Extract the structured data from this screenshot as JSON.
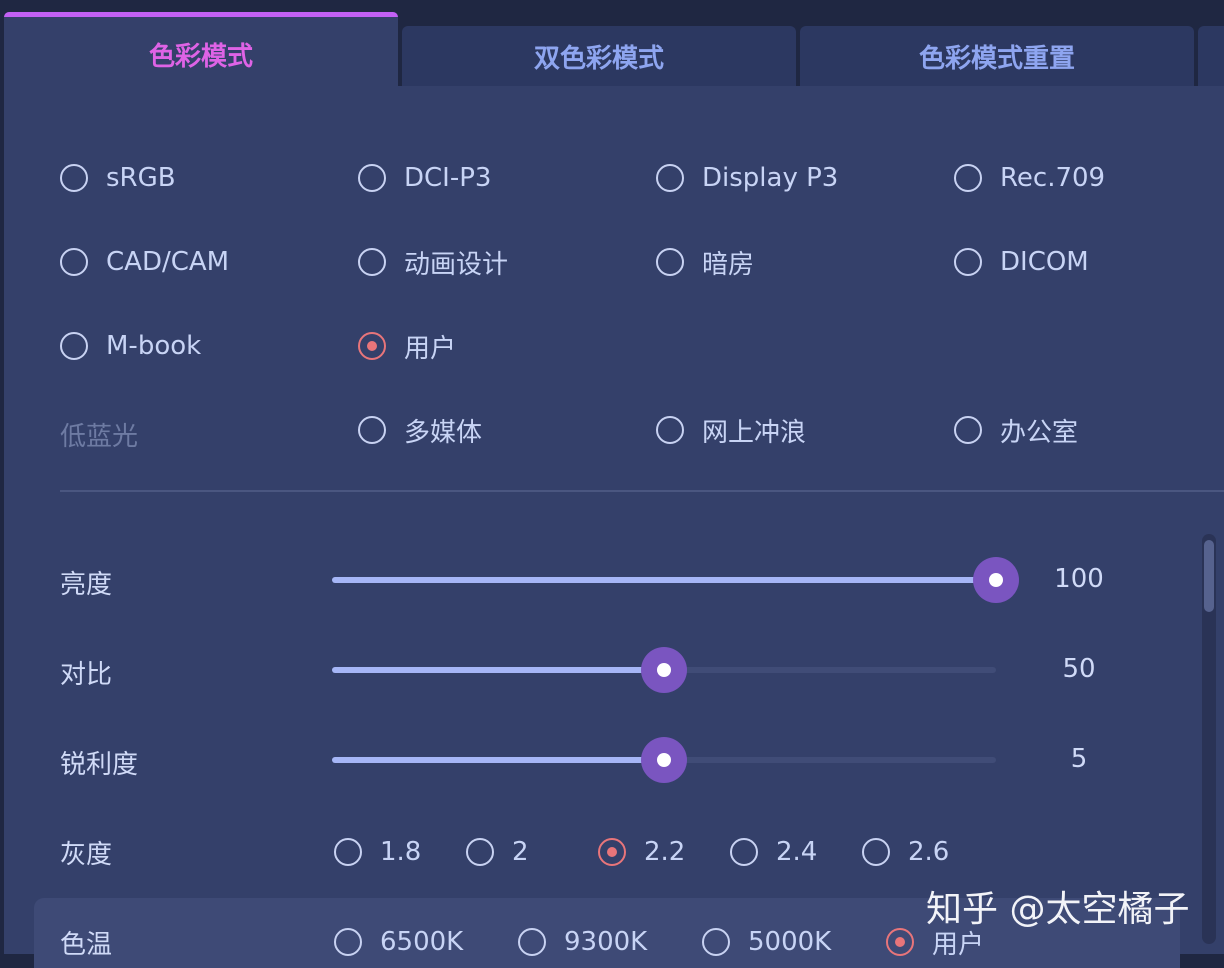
{
  "tabs": [
    {
      "label": "色彩模式",
      "active": true
    },
    {
      "label": "双色彩模式",
      "active": false
    },
    {
      "label": "色彩模式重置",
      "active": false
    }
  ],
  "color_modes": {
    "options": [
      "sRGB",
      "DCI-P3",
      "Display P3",
      "Rec.709",
      "CAD/CAM",
      "动画设计",
      "暗房",
      "DICOM",
      "M-book",
      "用户"
    ],
    "selected": "用户"
  },
  "low_blue_light": {
    "label": "低蓝光",
    "options": [
      "多媒体",
      "网上冲浪",
      "办公室"
    ]
  },
  "sliders": [
    {
      "label": "亮度",
      "value": "100",
      "percent": 100
    },
    {
      "label": "对比",
      "value": "50",
      "percent": 50
    },
    {
      "label": "锐利度",
      "value": "5",
      "percent": 50
    }
  ],
  "gamma": {
    "label": "灰度",
    "options": [
      "1.8",
      "2",
      "2.2",
      "2.4",
      "2.6"
    ],
    "selected": "2.2"
  },
  "color_temp": {
    "label": "色温",
    "options": [
      "6500K",
      "9300K",
      "5000K",
      "用户"
    ],
    "selected": "用户"
  },
  "watermark": "知乎 @太空橘子",
  "colors": {
    "accent_tab": "#de63e6",
    "radio_checked": "#e8757a",
    "slider_fill": "#a6b6f7",
    "thumb": "#7a55c0",
    "panel": "#34406a"
  }
}
